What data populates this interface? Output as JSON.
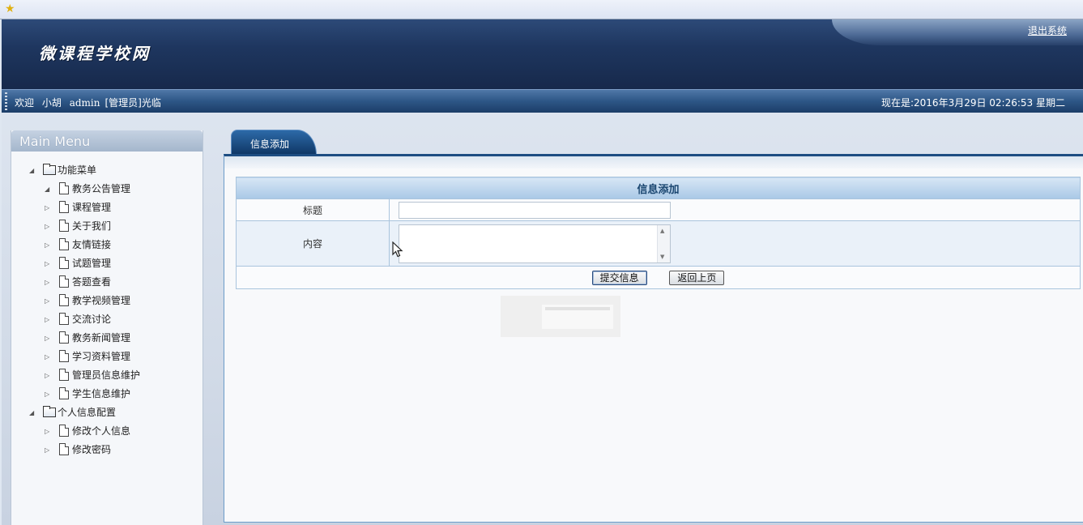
{
  "header": {
    "site_title": "微课程学校网",
    "logout_label": "退出系统"
  },
  "infobar": {
    "welcome_prefix": "欢迎",
    "user_name": "小胡",
    "user_account": "admin",
    "user_role": "[管理员]",
    "welcome_suffix": "光临",
    "clock_text": "现在是:2016年3月29日  02:26:53 星期二"
  },
  "sidebar": {
    "title": "Main Menu",
    "groups": [
      {
        "label": "功能菜单",
        "items": [
          "教务公告管理",
          "课程管理",
          "关于我们",
          "友情链接",
          "试题管理",
          "答题查看",
          "教学视频管理",
          "交流讨论",
          "教务新闻管理",
          "学习资料管理",
          "管理员信息维护",
          "学生信息维护"
        ]
      },
      {
        "label": "个人信息配置",
        "items": [
          "修改个人信息",
          "修改密码"
        ]
      }
    ]
  },
  "content": {
    "tab_label": "信息添加",
    "form_caption": "信息添加",
    "title_label": "标题",
    "title_value": "",
    "content_label": "内容",
    "content_value": "",
    "submit_label": "提交信息",
    "back_label": "返回上页"
  }
}
